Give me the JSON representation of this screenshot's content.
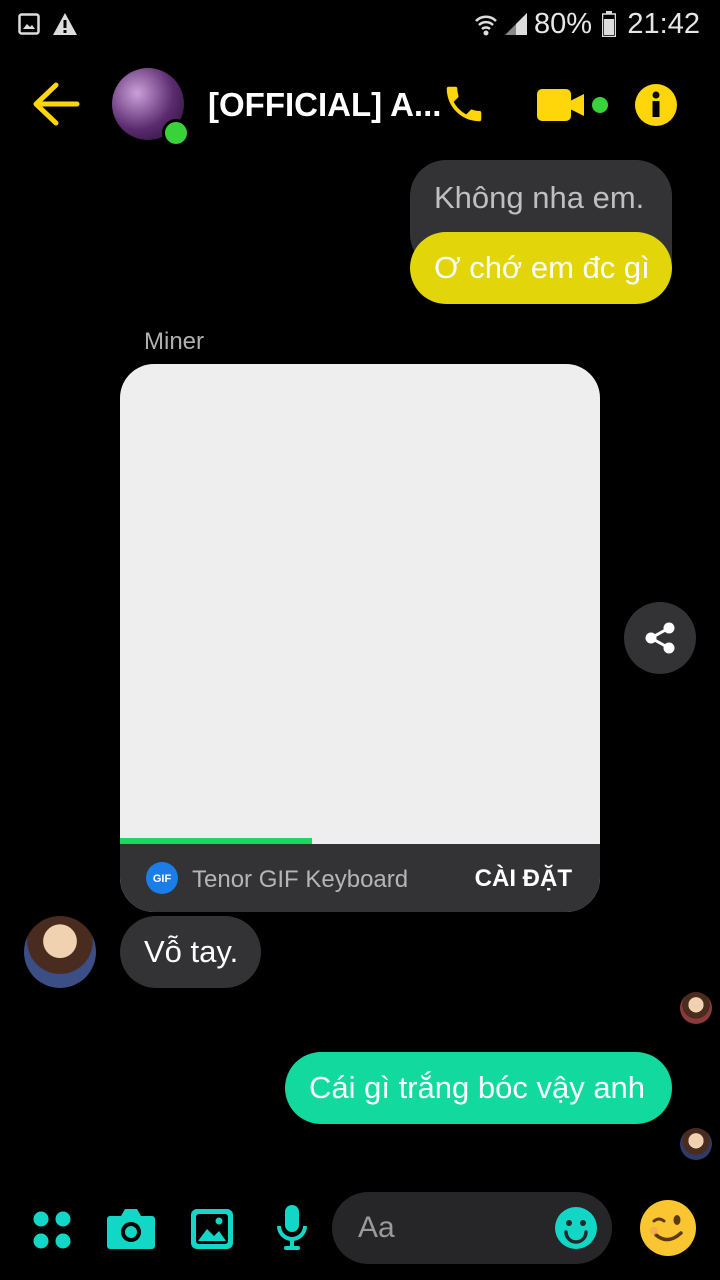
{
  "status_bar": {
    "battery": "80%",
    "time": "21:42"
  },
  "header": {
    "title": "[OFFICIAL] A..."
  },
  "messages": [
    {
      "text": "Không nha em."
    },
    {
      "text": "Ơ chớ em đc gì"
    },
    {
      "sender": "Miner"
    },
    {
      "gif": {
        "source": "Tenor GIF Keyboard",
        "install_label": "CÀI ĐẶT",
        "progress": 0.4
      }
    },
    {
      "text": "Vỗ tay."
    },
    {
      "text": "Cái gì trắng bóc vậy anh"
    }
  ],
  "composer": {
    "placeholder": "Aa"
  },
  "colors": {
    "accent_yellow": "#ffd60a",
    "accent_teal": "#12d6c6",
    "bubble_green": "#12d99e",
    "bubble_yellow": "#e2d50a"
  }
}
